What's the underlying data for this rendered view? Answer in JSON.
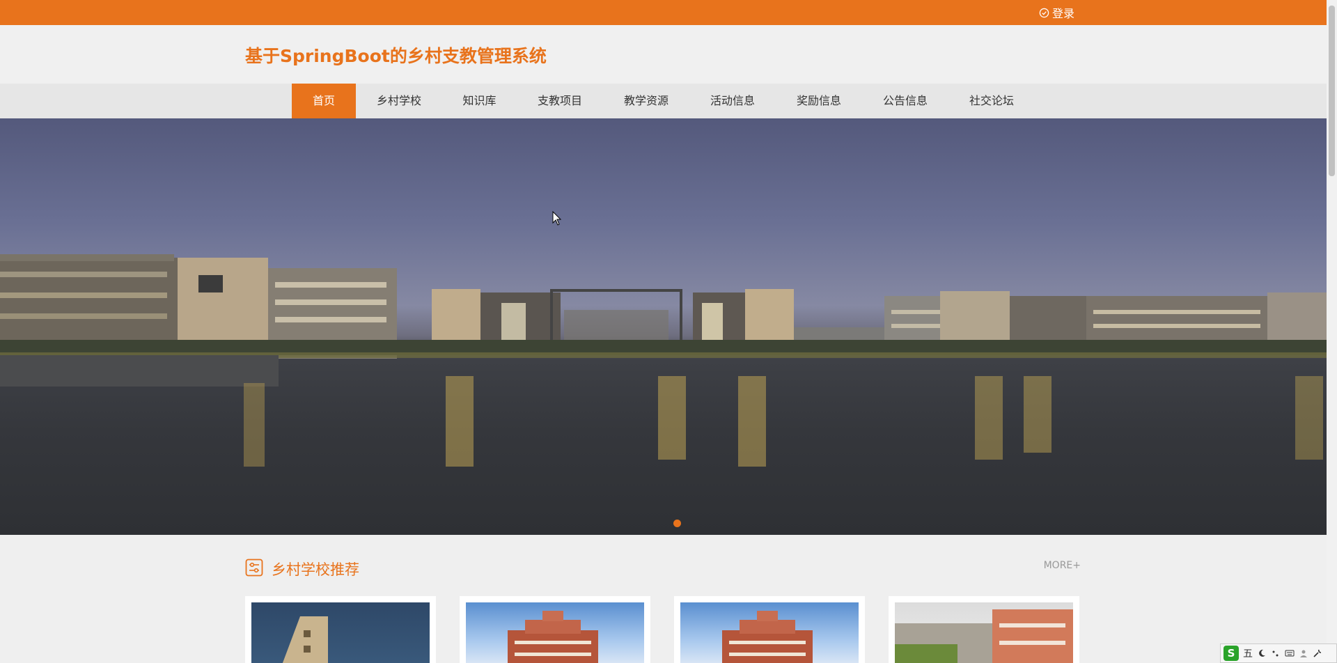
{
  "topbar": {
    "login_label": "登录",
    "accent": "#e8731c"
  },
  "header": {
    "site_title": "基于SpringBoot的乡村支教管理系统"
  },
  "nav": {
    "items": [
      {
        "label": "首页"
      },
      {
        "label": "乡村学校"
      },
      {
        "label": "知识库"
      },
      {
        "label": "支教项目"
      },
      {
        "label": "教学资源"
      },
      {
        "label": "活动信息"
      },
      {
        "label": "奖励信息"
      },
      {
        "label": "公告信息"
      },
      {
        "label": "社交论坛"
      }
    ],
    "active": "首页"
  },
  "carousel": {
    "slides": 1,
    "current": 1
  },
  "section": {
    "title": "乡村学校推荐",
    "more_label": "MORE+"
  },
  "ime": {
    "logo": "S",
    "mode": "五"
  }
}
